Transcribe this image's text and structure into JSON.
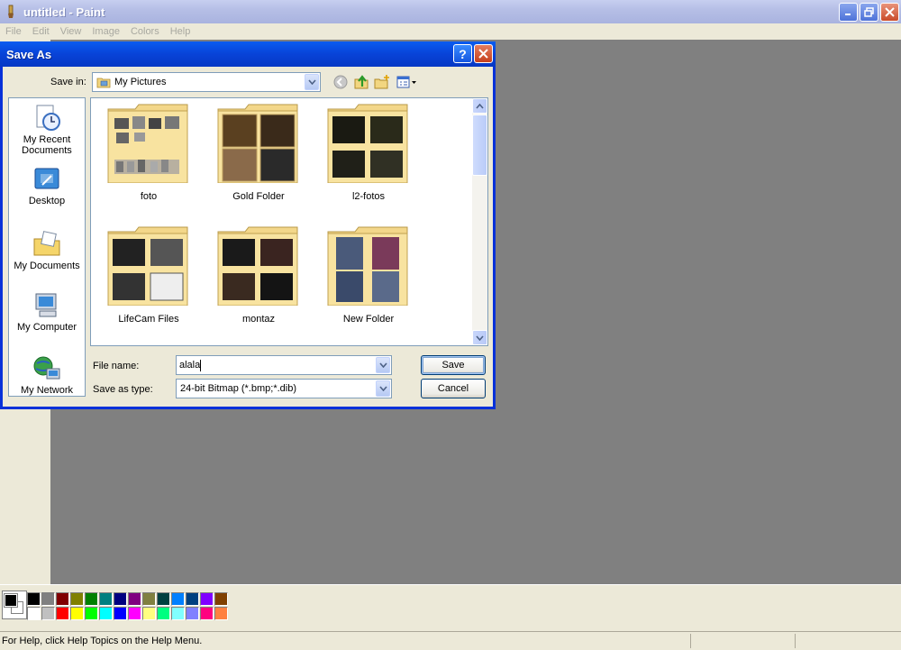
{
  "app": {
    "title": "untitled - Paint",
    "menu": [
      "File",
      "Edit",
      "View",
      "Image",
      "Colors",
      "Help"
    ]
  },
  "status": {
    "text": "For Help, click Help Topics on the Help Menu."
  },
  "palette": {
    "row1": [
      "#000000",
      "#808080",
      "#800000",
      "#808000",
      "#008000",
      "#008080",
      "#000080",
      "#800080",
      "#808040",
      "#004040",
      "#0080ff",
      "#004080",
      "#8000ff",
      "#804000"
    ],
    "row2": [
      "#ffffff",
      "#c0c0c0",
      "#ff0000",
      "#ffff00",
      "#00ff00",
      "#00ffff",
      "#0000ff",
      "#ff00ff",
      "#ffff80",
      "#00ff80",
      "#80ffff",
      "#8080ff",
      "#ff0080",
      "#ff8040"
    ]
  },
  "dialog": {
    "title": "Save As",
    "save_in_label": "Save in:",
    "save_in_value": "My Pictures",
    "places": [
      {
        "label": "My Recent Documents",
        "icon": "recent-documents-icon"
      },
      {
        "label": "Desktop",
        "icon": "desktop-icon"
      },
      {
        "label": "My Documents",
        "icon": "my-documents-icon"
      },
      {
        "label": "My Computer",
        "icon": "my-computer-icon"
      },
      {
        "label": "My Network",
        "icon": "my-network-icon"
      }
    ],
    "folders": [
      {
        "name": "foto"
      },
      {
        "name": "Gold Folder"
      },
      {
        "name": "l2-fotos"
      },
      {
        "name": "LifeCam Files"
      },
      {
        "name": "montaz"
      },
      {
        "name": "New Folder"
      }
    ],
    "file_name_label": "File name:",
    "file_name_value": "alala",
    "save_type_label": "Save as type:",
    "save_type_value": "24-bit Bitmap (*.bmp;*.dib)",
    "save_button": "Save",
    "cancel_button": "Cancel",
    "help_glyph": "?"
  }
}
